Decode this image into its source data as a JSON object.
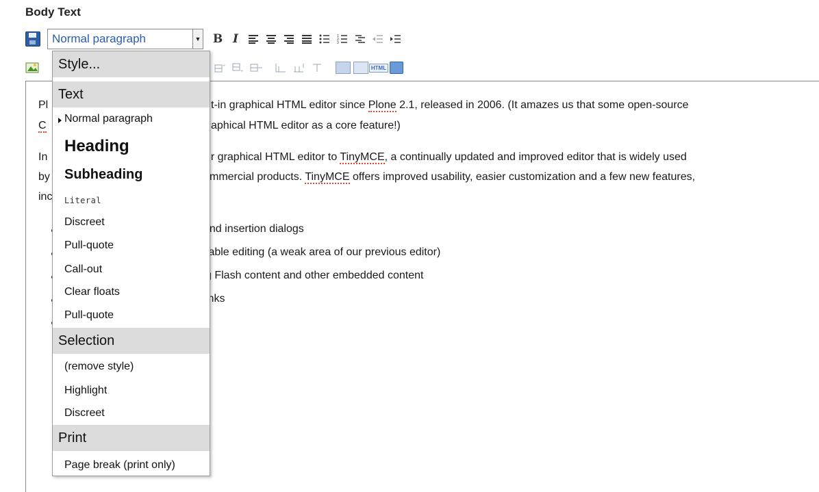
{
  "field_label": "Body Text",
  "toolbar": {
    "style_select_value": "Normal paragraph",
    "bold_label": "B",
    "italic_label": "I",
    "html_label": "HTML"
  },
  "editor": {
    "lines": [
      "Pl",
      "t-in graphical HTML editor since ",
      "Plone",
      " 2.1, released in 2006.  (It amazes us that some open-source",
      "C",
      "aphical HTML editor as a core feature!)",
      "In",
      "ur graphical HTML editor to ",
      "TinyMCE",
      ", a continually updated and improved editor that is widely used",
      "by",
      "mmercial products. ",
      "TinyMCE",
      " offers improved usability, easier customization and a few new features,",
      "inc"
    ],
    "bullets": [
      "and insertion dialogs",
      "table editing (a weak area of our previous editor)",
      "g Flash content and other embedded content",
      "inks"
    ]
  },
  "menu": {
    "style_header": "Style...",
    "sections": [
      {
        "header": "Text",
        "items": [
          "Normal paragraph",
          "Heading",
          "Subheading",
          "Literal",
          "Discreet",
          "Pull-quote",
          "Call-out",
          "Clear floats",
          "Pull-quote"
        ]
      },
      {
        "header": "Selection",
        "items": [
          "(remove style)",
          "Highlight",
          "Discreet"
        ]
      },
      {
        "header": "Print",
        "items": [
          "Page break (print only)"
        ]
      }
    ]
  }
}
